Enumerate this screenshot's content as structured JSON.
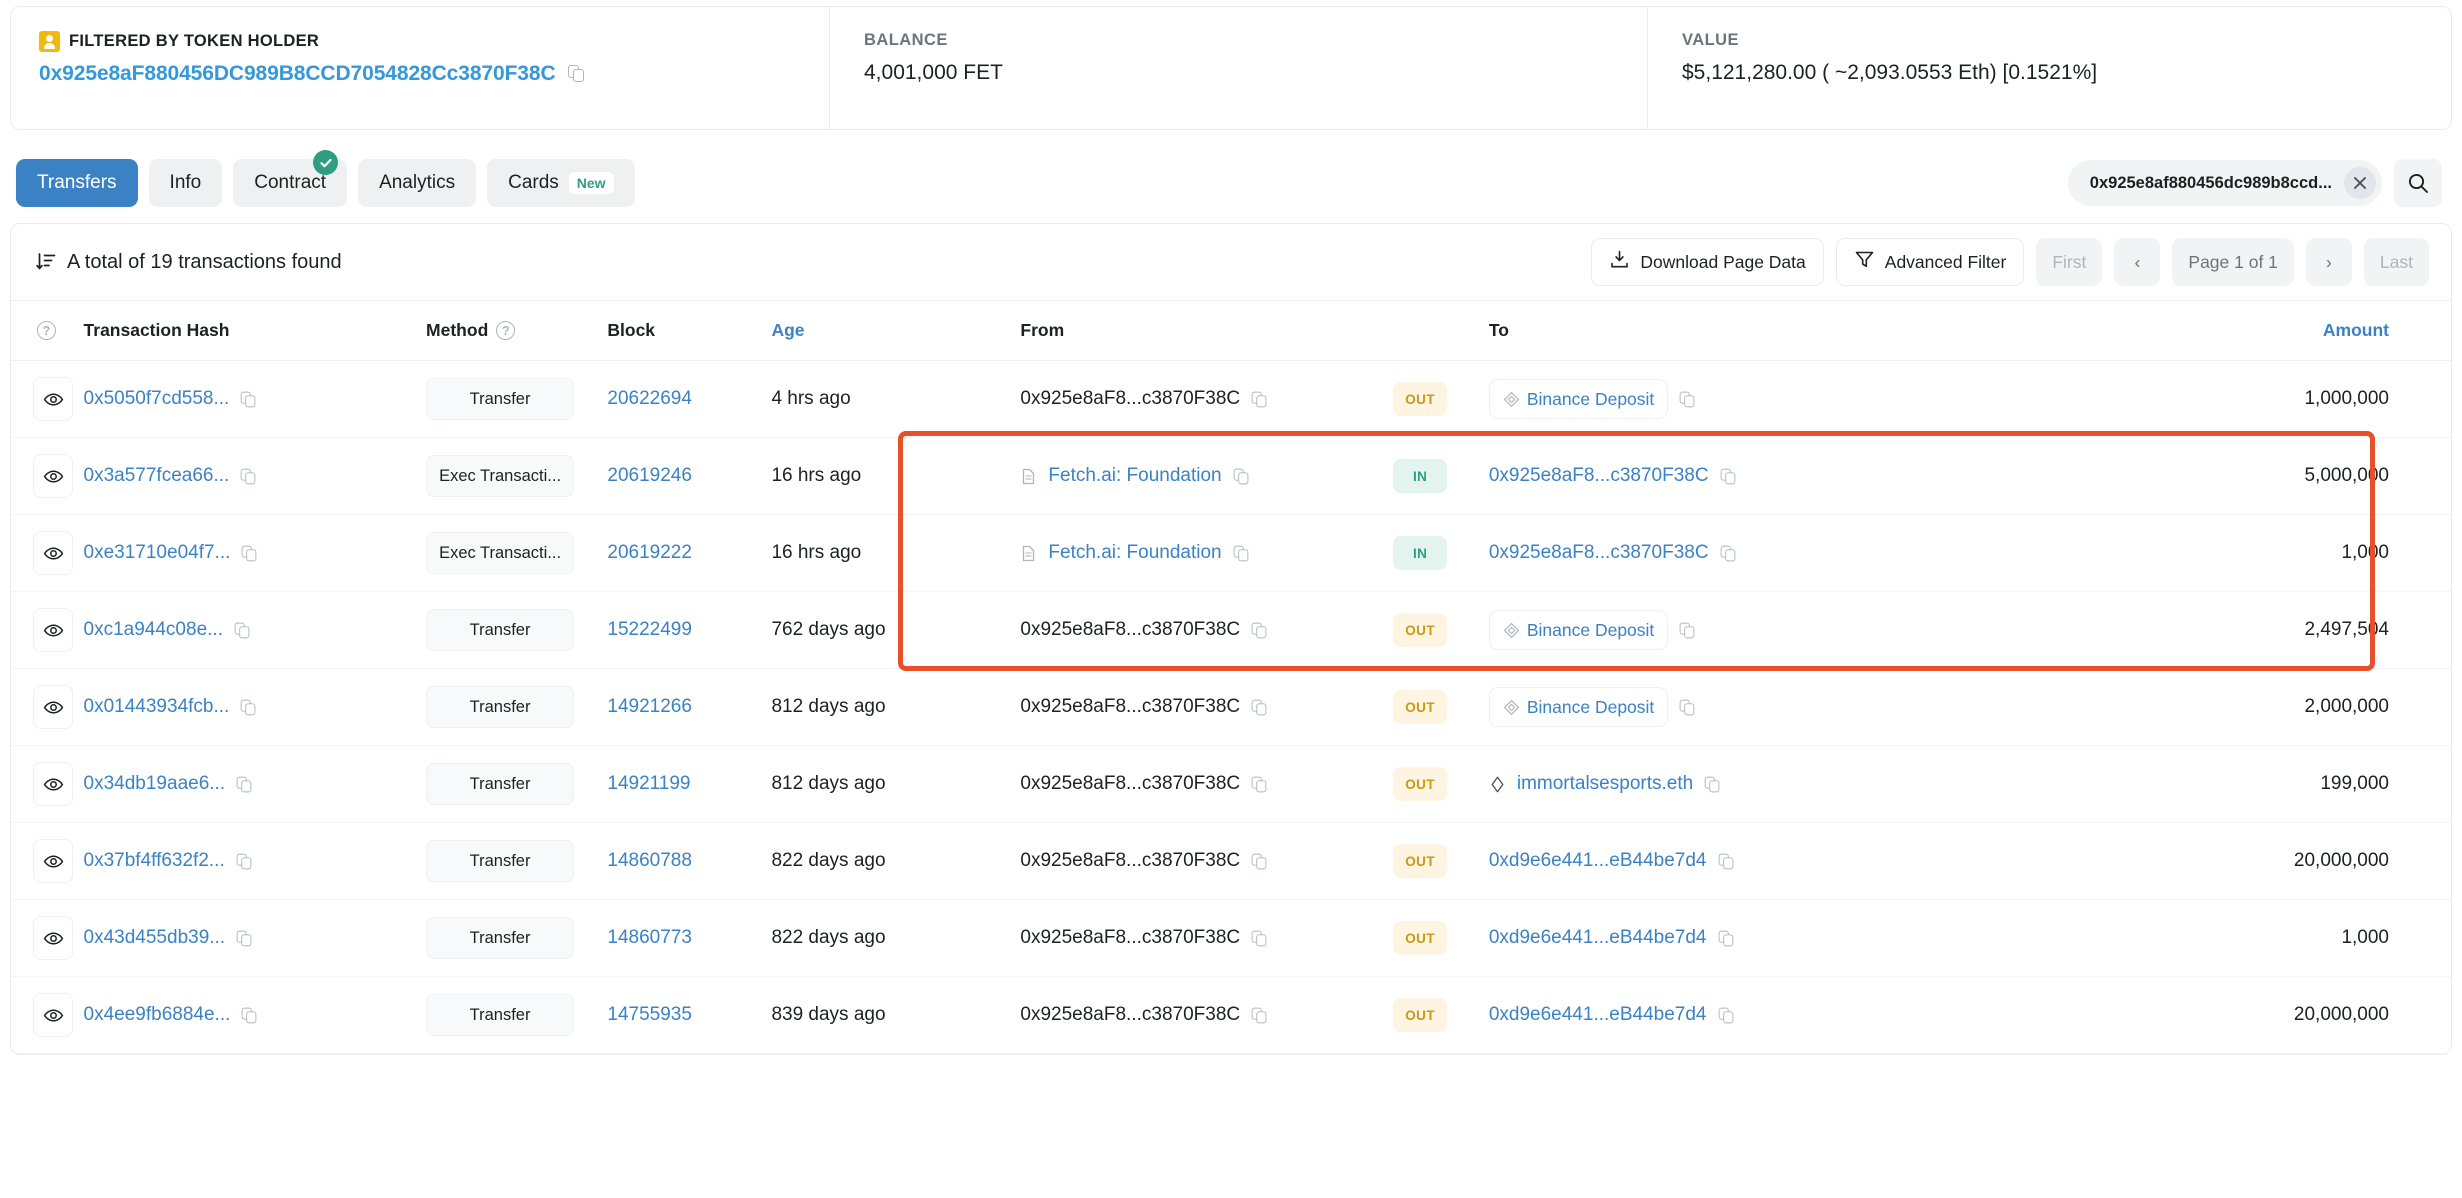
{
  "summary": {
    "filter_label": "FILTERED BY TOKEN HOLDER",
    "filter_address": "0x925e8aF880456DC989B8CCD7054828Cc3870F38C",
    "balance_label": "BALANCE",
    "balance_value": "4,001,000 FET",
    "value_label": "VALUE",
    "value_value": "$5,121,280.00 ( ~2,093.0553 Eth) [0.1521%]"
  },
  "tabs": [
    {
      "label": "Transfers",
      "active": true
    },
    {
      "label": "Info",
      "active": false
    },
    {
      "label": "Contract",
      "active": false,
      "verified": true
    },
    {
      "label": "Analytics",
      "active": false
    },
    {
      "label": "Cards",
      "active": false,
      "badge": "New"
    }
  ],
  "search": {
    "value": "0x925e8af880456dc989b8ccd...",
    "clear_label": "×",
    "icon": "search-icon"
  },
  "toolbar": {
    "total_text": "A total of 19 transactions found",
    "download_label": "Download Page Data",
    "advanced_filter_label": "Advanced Filter",
    "first_label": "First",
    "prev_label": "‹",
    "page_label": "Page 1 of 1",
    "next_label": "›",
    "last_label": "Last"
  },
  "table": {
    "headers": {
      "info": "?",
      "hash": "Transaction Hash",
      "method": "Method",
      "method_help": "?",
      "block": "Block",
      "age": "Age",
      "from": "From",
      "to": "To",
      "amount": "Amount"
    },
    "rows": [
      {
        "hash": "0x5050f7cd558...",
        "method": "Transfer",
        "block": "20622694",
        "age": "4 hrs ago",
        "from": "0x925e8aF8...c3870F38C",
        "from_type": "address",
        "direction": "OUT",
        "to": "Binance Deposit",
        "to_type": "tag",
        "to_icon": "diamond-icon",
        "amount": "1,000,000"
      },
      {
        "hash": "0x3a577fcea66...",
        "method": "Exec Transacti...",
        "block": "20619246",
        "age": "16 hrs ago",
        "from": "Fetch.ai: Foundation",
        "from_type": "named",
        "from_icon": "document-icon",
        "direction": "IN",
        "to": "0x925e8aF8...c3870F38C",
        "to_type": "address",
        "amount": "5,000,000"
      },
      {
        "hash": "0xe31710e04f7...",
        "method": "Exec Transacti...",
        "block": "20619222",
        "age": "16 hrs ago",
        "from": "Fetch.ai: Foundation",
        "from_type": "named",
        "from_icon": "document-icon",
        "direction": "IN",
        "to": "0x925e8aF8...c3870F38C",
        "to_type": "address",
        "amount": "1,000"
      },
      {
        "hash": "0xc1a944c08e...",
        "method": "Transfer",
        "block": "15222499",
        "age": "762 days ago",
        "from": "0x925e8aF8...c3870F38C",
        "from_type": "address",
        "direction": "OUT",
        "to": "Binance Deposit",
        "to_type": "tag",
        "to_icon": "diamond-icon",
        "amount": "2,497,504"
      },
      {
        "hash": "0x01443934fcb...",
        "method": "Transfer",
        "block": "14921266",
        "age": "812 days ago",
        "from": "0x925e8aF8...c3870F38C",
        "from_type": "address",
        "direction": "OUT",
        "to": "Binance Deposit",
        "to_type": "tag",
        "to_icon": "diamond-icon",
        "amount": "2,000,000"
      },
      {
        "hash": "0x34db19aae6...",
        "method": "Transfer",
        "block": "14921199",
        "age": "812 days ago",
        "from": "0x925e8aF8...c3870F38C",
        "from_type": "address",
        "direction": "OUT",
        "to": "immortalsesports.eth",
        "to_type": "ens",
        "to_icon": "ens-diamond-icon",
        "amount": "199,000"
      },
      {
        "hash": "0x37bf4ff632f2...",
        "method": "Transfer",
        "block": "14860788",
        "age": "822 days ago",
        "from": "0x925e8aF8...c3870F38C",
        "from_type": "address",
        "direction": "OUT",
        "to": "0xd9e6e441...eB44be7d4",
        "to_type": "address",
        "amount": "20,000,000"
      },
      {
        "hash": "0x43d455db39...",
        "method": "Transfer",
        "block": "14860773",
        "age": "822 days ago",
        "from": "0x925e8aF8...c3870F38C",
        "from_type": "address",
        "direction": "OUT",
        "to": "0xd9e6e441...eB44be7d4",
        "to_type": "address",
        "amount": "1,000"
      },
      {
        "hash": "0x4ee9fb6884e...",
        "method": "Transfer",
        "block": "14755935",
        "age": "839 days ago",
        "from": "0x925e8aF8...c3870F38C",
        "from_type": "address",
        "direction": "OUT",
        "to": "0xd9e6e441...eB44be7d4",
        "to_type": "address",
        "amount": "20,000,000"
      }
    ]
  },
  "highlight": {
    "color": "#e8502a",
    "rows": [
      0,
      1,
      2
    ]
  }
}
